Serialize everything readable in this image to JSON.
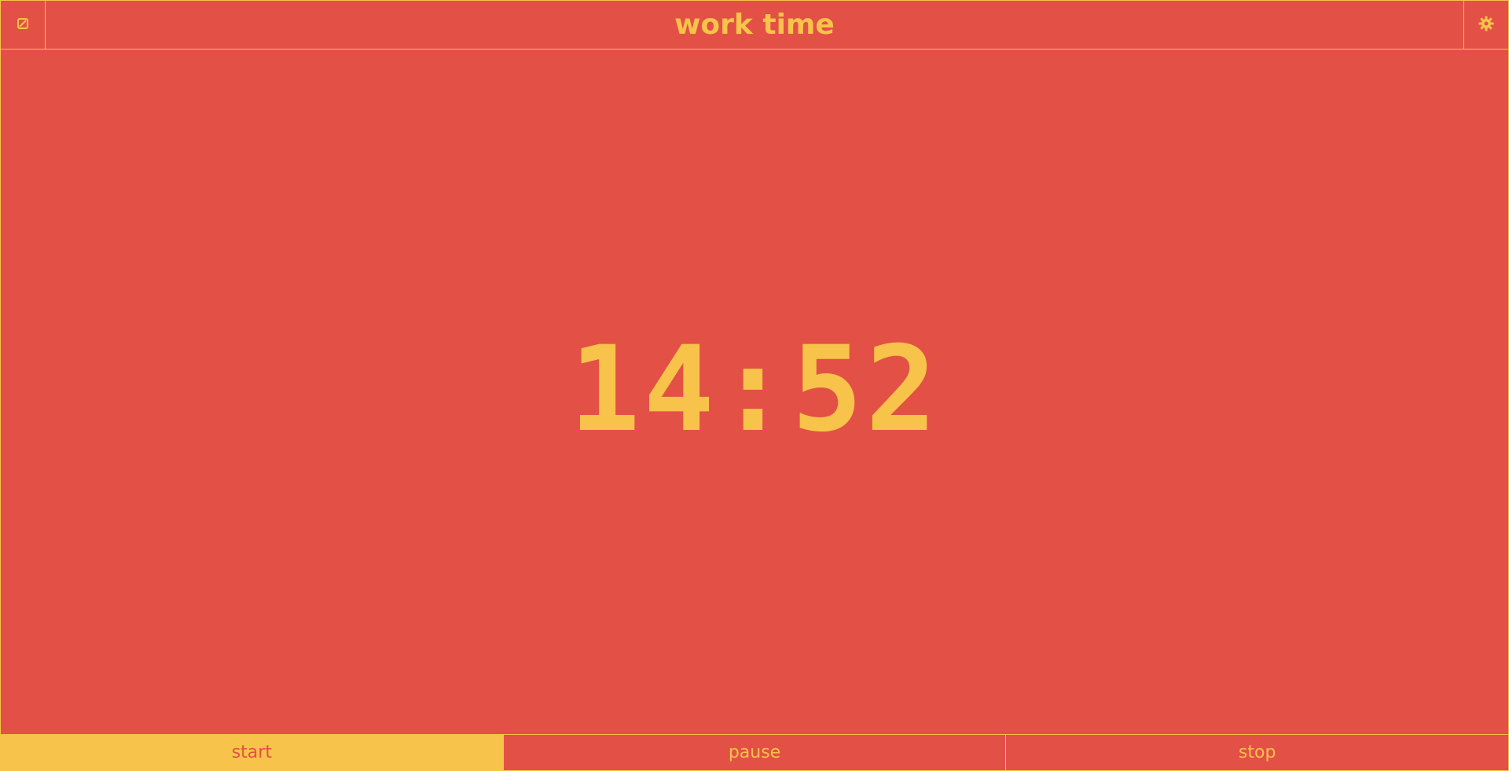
{
  "header": {
    "title": "work time",
    "left_icon": "edit-icon",
    "right_icon": "gear-icon"
  },
  "timer": {
    "display": "14:52"
  },
  "controls": {
    "start_label": "start",
    "pause_label": "pause",
    "stop_label": "stop",
    "active": "start"
  },
  "colors": {
    "background": "#e35045",
    "accent": "#f7c34a"
  }
}
